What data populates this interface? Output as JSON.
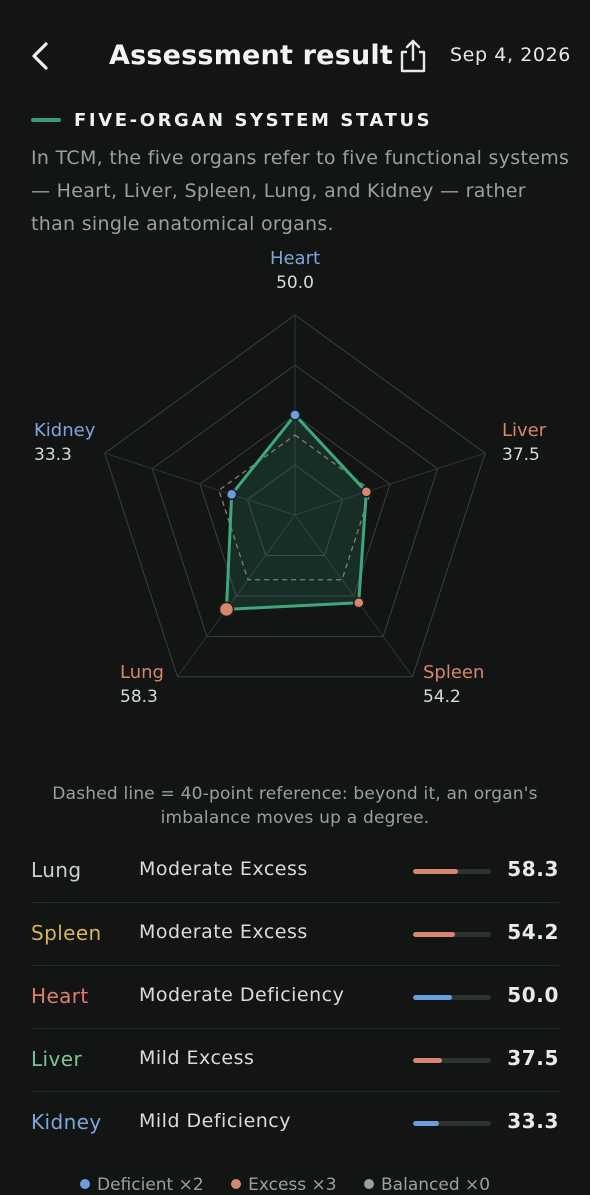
{
  "header": {
    "title": "Assessment result",
    "date": "Sep 4, 2026"
  },
  "icons": {
    "back": "chevron-left-icon",
    "share": "share-icon"
  },
  "section": {
    "title": "FIVE-ORGAN SYSTEM STATUS",
    "description": "In TCM, the five organs refer to five functional systems — Heart, Liver, Spleen, Lung, and Kidney — rather than single anatomical organs."
  },
  "colors": {
    "accent": "#3a9a72",
    "deficient": "#6a9ee0",
    "excess": "#d98670",
    "balanced": "#9aa09d"
  },
  "chart_data": {
    "type": "radar",
    "axes": [
      "Heart",
      "Liver",
      "Spleen",
      "Lung",
      "Kidney"
    ],
    "values": [
      50.0,
      37.5,
      54.2,
      58.3,
      33.3
    ],
    "value_labels": [
      "50.0",
      "37.5",
      "54.2",
      "58.3",
      "33.3"
    ],
    "label_colors": [
      "#7fa6dc",
      "#d98670",
      "#d98670",
      "#d98670",
      "#7fa6dc"
    ],
    "point_types": [
      "deficient",
      "excess",
      "excess",
      "excess",
      "deficient"
    ],
    "reference": 40,
    "range": [
      0,
      100
    ],
    "rings": 4
  },
  "reference_note": "Dashed line = 40-point reference: beyond it, an organ's imbalance moves up a degree.",
  "organs": [
    {
      "name": "Lung",
      "status": "Moderate Excess",
      "score": "58.3",
      "value": 58.3,
      "name_color": "#c9cfcc",
      "bar_color": "#d98670"
    },
    {
      "name": "Spleen",
      "status": "Moderate Excess",
      "score": "54.2",
      "value": 54.2,
      "name_color": "#d9b25a",
      "bar_color": "#d98670"
    },
    {
      "name": "Heart",
      "status": "Moderate Deficiency",
      "score": "50.0",
      "value": 50.0,
      "name_color": "#e07c6c",
      "bar_color": "#6a9ee0"
    },
    {
      "name": "Liver",
      "status": "Mild Excess",
      "score": "37.5",
      "value": 37.5,
      "name_color": "#79c594",
      "bar_color": "#d98670"
    },
    {
      "name": "Kidney",
      "status": "Mild Deficiency",
      "score": "33.3",
      "value": 33.3,
      "name_color": "#7fa6dc",
      "bar_color": "#6a9ee0"
    }
  ],
  "legend": [
    {
      "label": "Deficient ×2",
      "color": "#6a9ee0"
    },
    {
      "label": "Excess ×3",
      "color": "#d98670"
    },
    {
      "label": "Balanced ×0",
      "color": "#9aa09d"
    }
  ]
}
